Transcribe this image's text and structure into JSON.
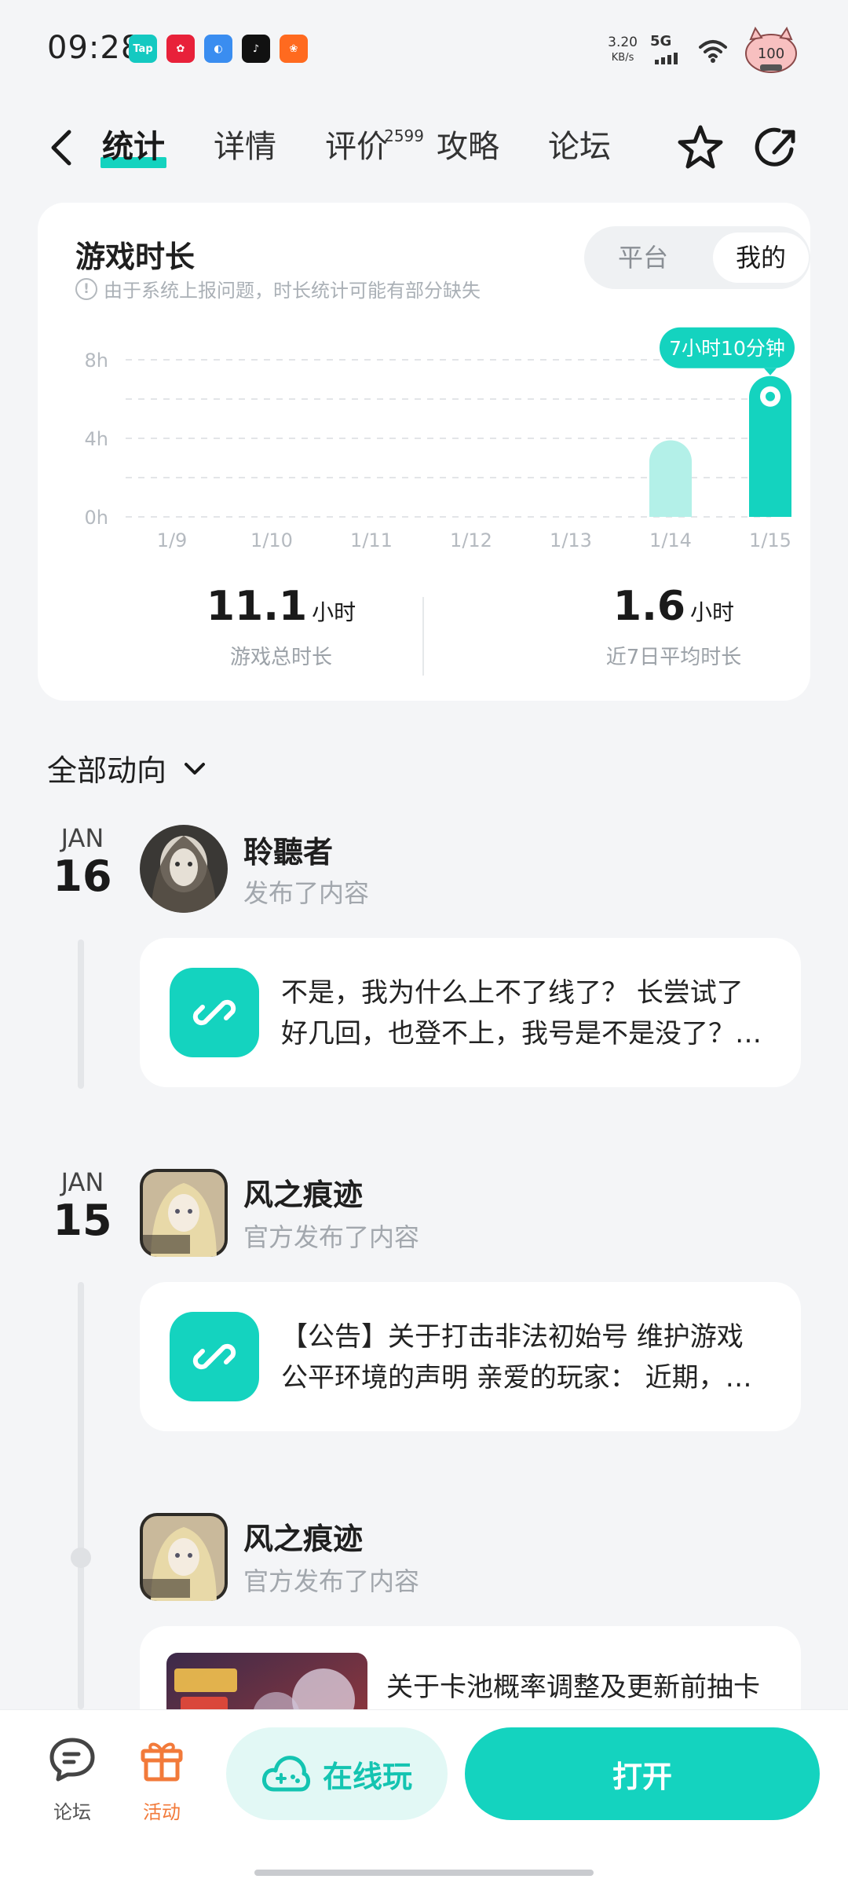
{
  "status_bar": {
    "time": "09:28",
    "app_icons": [
      {
        "name": "taptap-icon",
        "label": "Tap",
        "color": "#14c9c1"
      },
      {
        "name": "red-app-icon",
        "label": "✿",
        "color": "#e8213a"
      },
      {
        "name": "blue-app-icon",
        "label": "◐",
        "color": "#3a8df0"
      },
      {
        "name": "music-app-icon",
        "label": "♪",
        "color": "#111111"
      },
      {
        "name": "orange-app-icon",
        "label": "❀",
        "color": "#ff6a1f"
      }
    ],
    "speed_value": "3.20",
    "speed_unit": "KB/s",
    "network": "5G",
    "battery": "100"
  },
  "nav": {
    "tabs": [
      {
        "label": "统计",
        "active": true
      },
      {
        "label": "详情"
      },
      {
        "label": "评价",
        "badge": "2599"
      },
      {
        "label": "攻略"
      },
      {
        "label": "论坛"
      }
    ]
  },
  "stats": {
    "title": "游戏时长",
    "notice": "由于系统上报问题，时长统计可能有部分缺失",
    "toggle": {
      "platform": "平台",
      "mine": "我的"
    },
    "total_value": "11.1",
    "total_unit": "小时",
    "total_caption": "游戏总时长",
    "avg_value": "1.6",
    "avg_unit": "小时",
    "avg_caption": "近7日平均时长"
  },
  "chart_data": {
    "type": "bar",
    "categories": [
      "1/9",
      "1/10",
      "1/11",
      "1/12",
      "1/13",
      "1/14",
      "1/15"
    ],
    "values": [
      0,
      0,
      0,
      0,
      0,
      3.9,
      7.17
    ],
    "y_ticks": [
      "0h",
      "4h",
      "8h"
    ],
    "ylim": [
      0,
      8
    ],
    "highlight_label": "7小时10分钟",
    "highlight_index": 6,
    "colors": {
      "bar": "#b3f0e8",
      "highlight": "#14d3bf",
      "grid": "#e3e5e8",
      "tick": "#b5bac0"
    }
  },
  "feed": {
    "filter_label": "全部动向",
    "entries": [
      {
        "month": "JAN",
        "day": "16",
        "author": "聆聽者",
        "action": "发布了内容",
        "text": "不是，我为什么上不了线了？ 长尝试了好几回，也登不上，我号是不是没了？[表情]"
      },
      {
        "month": "JAN",
        "day": "15",
        "author": "风之痕迹",
        "action": "官方发布了内容",
        "text": "【公告】关于打击非法初始号 维护游戏公平环境的声明 亲爱的玩家： 近期，有部分玩家反馈"
      },
      {
        "author": "风之痕迹",
        "action": "官方发布了内容",
        "text": "关于卡池概率调整及更新前抽卡"
      }
    ]
  },
  "bottom_bar": {
    "forum_label": "论坛",
    "activity_label": "活动",
    "cloud_label": "在线玩",
    "open_label": "打开"
  }
}
